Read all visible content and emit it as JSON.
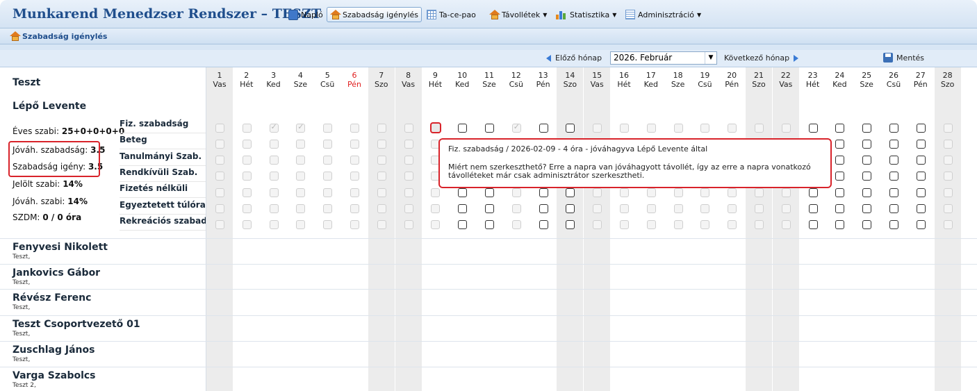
{
  "app": {
    "title": "Munkarend Menedzser Rendszer – TESZT",
    "menu": [
      {
        "label": "Napló",
        "icon": "book-icon"
      },
      {
        "label": "Szabadság igénylés",
        "icon": "home-icon",
        "active": true
      },
      {
        "label": "Ta-ce-pao",
        "icon": "grid-icon"
      },
      {
        "label": "Távollétek",
        "icon": "home-icon",
        "dropdown": true
      },
      {
        "label": "Statisztika",
        "icon": "bar-chart-icon",
        "dropdown": true
      },
      {
        "label": "Adminisztráció",
        "icon": "list-icon",
        "dropdown": true
      }
    ]
  },
  "page": {
    "title": "Szabadság igénylés"
  },
  "nav": {
    "prev": "Előző hónap",
    "month": "2026. Február",
    "next": "Következő hónap",
    "save": "Mentés"
  },
  "team": "Teszt",
  "days": [
    {
      "n": "1",
      "d": "Vas"
    },
    {
      "n": "2",
      "d": "Hét"
    },
    {
      "n": "3",
      "d": "Ked"
    },
    {
      "n": "4",
      "d": "Sze"
    },
    {
      "n": "5",
      "d": "Csü"
    },
    {
      "n": "6",
      "d": "Pén"
    },
    {
      "n": "7",
      "d": "Szo"
    },
    {
      "n": "8",
      "d": "Vas"
    },
    {
      "n": "9",
      "d": "Hét"
    },
    {
      "n": "10",
      "d": "Ked"
    },
    {
      "n": "11",
      "d": "Sze"
    },
    {
      "n": "12",
      "d": "Csü"
    },
    {
      "n": "13",
      "d": "Pén"
    },
    {
      "n": "14",
      "d": "Szo"
    },
    {
      "n": "15",
      "d": "Vas"
    },
    {
      "n": "16",
      "d": "Hét"
    },
    {
      "n": "17",
      "d": "Ked"
    },
    {
      "n": "18",
      "d": "Sze"
    },
    {
      "n": "19",
      "d": "Csü"
    },
    {
      "n": "20",
      "d": "Pén"
    },
    {
      "n": "21",
      "d": "Szo"
    },
    {
      "n": "22",
      "d": "Vas"
    },
    {
      "n": "23",
      "d": "Hét"
    },
    {
      "n": "24",
      "d": "Ked"
    },
    {
      "n": "25",
      "d": "Sze"
    },
    {
      "n": "26",
      "d": "Csü"
    },
    {
      "n": "27",
      "d": "Pén"
    },
    {
      "n": "28",
      "d": "Szo"
    }
  ],
  "holiday_days": [
    "6"
  ],
  "colors": {
    "accent": "#1f4e8c",
    "highlight": "#d8232a",
    "holiday": "#e02020"
  },
  "employee": {
    "name": "Lépő Levente",
    "stats": [
      {
        "label": "Éves szabi:",
        "value": "25+0+0+0+0"
      },
      {
        "label": "Jóváh. szabadság:",
        "value": "3.5"
      },
      {
        "label": "Szabadság igény:",
        "value": "3.5"
      },
      {
        "label": "Jelölt szabi:",
        "value": "14%"
      },
      {
        "label": "Jóváh. szabi:",
        "value": "14%"
      },
      {
        "label": "SZDM:",
        "value": "0 / 0 óra"
      }
    ],
    "categories": [
      "Fiz. szabadság",
      "Beteg",
      "Tanulmányi Szab.",
      "Rendkívüli Szab.",
      "Fizetés nélküli",
      "Egyeztetett túlóra",
      "Rekreációs szabadság"
    ]
  },
  "tooltip": {
    "line1": "Fiz. szabadság / 2026-02-09 - 4 óra - jóváhagyva Lépő Levente által",
    "line2": "Miért nem szerkeszthető? Erre a napra van jóváhagyott távollét, így az erre a napra vonatkozó",
    "line3": "távolléteket már csak adminisztrátor szerkesztheti."
  },
  "others": [
    {
      "name": "Fenyvesi Nikolett",
      "sub": "Teszt,"
    },
    {
      "name": "Jankovics Gábor",
      "sub": "Teszt,"
    },
    {
      "name": "Révész Ferenc",
      "sub": "Teszt,"
    },
    {
      "name": "Teszt Csoportvezető 01",
      "sub": "Teszt,"
    },
    {
      "name": "Zuschlag János",
      "sub": "Teszt,"
    },
    {
      "name": "Varga Szabolcs",
      "sub": "Teszt 2,"
    }
  ]
}
